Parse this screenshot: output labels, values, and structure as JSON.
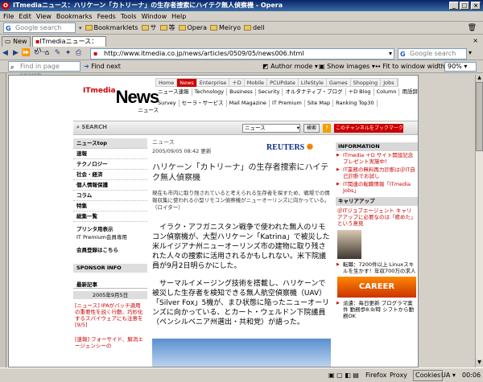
{
  "window": {
    "title": "ITmediaニュース：ハリケーン「カトリーナ」の生存者捜索にハイテク無人偵察機 - Opera"
  },
  "menu": [
    "File",
    "Edit",
    "View",
    "Bookmarks",
    "Feeds",
    "Tools",
    "Window",
    "Help"
  ],
  "personal": {
    "search_placeholder": "Google search",
    "items": [
      "Bookmarklets",
      "サ",
      "等",
      "Opera",
      "Meiryo",
      "dell"
    ]
  },
  "tabs": {
    "new": "New",
    "active": "ITmediaニュース：ハ..."
  },
  "nav": {
    "url": "http://www.itmedia.co.jp/news/articles/0509/05/news006.html",
    "search_placeholder": "Google search"
  },
  "view": {
    "find_placeholder": "Find in page search",
    "find_next": "Find next",
    "author_mode": "Author mode",
    "show_images": "Show images",
    "fit": "Fit to window width",
    "zoom": "90%"
  },
  "site": {
    "logo_it": "ITmedia",
    "logo_news": "News",
    "logo_sub": "ニュース",
    "top_tabs": [
      "Home",
      "News",
      "Enterprise",
      "＋D",
      "Mobile",
      "PCUPdate",
      "LifeStyle",
      "Games",
      "Shopping",
      "Jobs"
    ],
    "sub1": [
      "ニュース速報",
      "Technology",
      "Business",
      "Security",
      "オルタナティブ・ブログ",
      "＋D Blog",
      "Column",
      "用語辞典"
    ],
    "sub2": [
      "Survey",
      "セーラ・サービス",
      "Mail Magazine",
      "IT Premium",
      "Site Map",
      "Ranking Top30"
    ],
    "search_label": "SEARCH",
    "search_select": "ニュース",
    "search_btn": "検索",
    "bookmark_btn": "このチャンネルをブックマーク"
  },
  "leftnav": {
    "items": [
      "ニュースtop",
      "速報",
      "テクノロジー",
      "社会・経済",
      "個人情報保護",
      "コラム",
      "特集",
      "総集一覧"
    ],
    "print": "プリンタ用表示",
    "print_sub": "IT Premium会員専用",
    "mail": "会員登録はこちら",
    "sponsor": "SPONSOR INFO",
    "latest": "最新記事",
    "date": "2005年9月5日",
    "news1": "[ニュース] IPAがバッチ適用の重要性を説く行動、巧妙化するスパイウェアにも注意を [9/5]",
    "news2": "[速報] フォーサイド、解消エージェンシーの"
  },
  "article": {
    "section": "ニュース",
    "date": "2005/09/05 08:42 更新",
    "reuters": "REUTERS",
    "title": "ハリケーン「カトリーナ」の生存者捜索にハイテク無人偵察機",
    "lead": "現在も市内に取り残されていると考えられる生存者を探すため、戦場での情報収集に使われる小型リモコン偵察機がニューオーリンズに向かっている。（ロイター）",
    "p1": "イラク・アフガニスタン戦争で使われた無人のリモコン偵察機が、大型ハリケーン「Katrina」で被災した米ルイジアナ州ニューオーリンズ市の建物に取り残された人々の捜索に活用されるかもしれない。米下院議員が9月2日明らかにした。",
    "p2": "サーマルイメージング技術を搭載し、ハリケーンで被災した生存者を検知できる無人航空偵察機（UAV）「Silver Fox」5機が、まひ状態に陥ったニューオーリンズに向かっている、とカート・ウェルドン下院議員（ペンシルベニア州選出・共和党）が語った。"
  },
  "right": {
    "info_head": "INFORMATION",
    "info": [
      "ITmedia ＋D サイト開設記念プレゼント実施中！",
      "IT業務の無料再力診断は＠IT自己診断でお試し",
      "IT関連の転職情報「ITmedia Jobs」"
    ],
    "career_head": "キャリアアップ",
    "career_text": "＠ITジョブエージェント キャリアアップに必要なのは「癒めた」という意見",
    "ad1": "転職：7200件以上 Linuxスキルを生かす！年収700万の求人",
    "career_banner": "CAREER",
    "ad2": "派遣：毎日更新 プログラマ案件 勤務歩8.9/時 シフトから勤務OK"
  },
  "status": {
    "firefox": "Firefox",
    "proxy": "Proxy",
    "cookies": "Cookies",
    "ua": "UA",
    "time": "00:06"
  }
}
